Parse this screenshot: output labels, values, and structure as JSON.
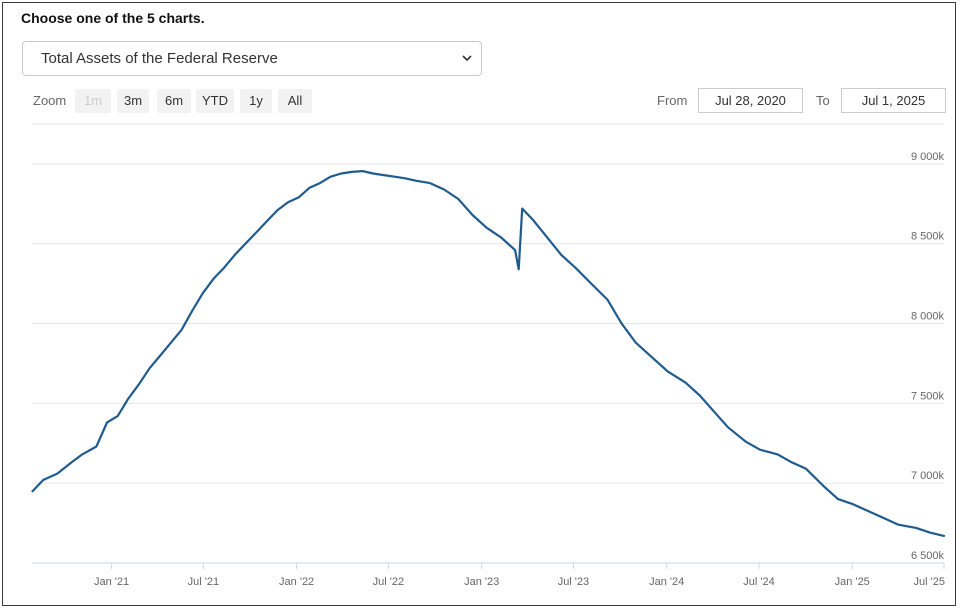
{
  "heading": "Choose one of the 5 charts.",
  "selector": {
    "selected": "Total Assets of the Federal Reserve"
  },
  "zoom": {
    "label": "Zoom",
    "buttons": [
      "1m",
      "3m",
      "6m",
      "YTD",
      "1y",
      "All"
    ],
    "disabled": "1m"
  },
  "range": {
    "from_label": "From",
    "from": "Jul 28, 2020",
    "to_label": "To",
    "to": "Jul 1, 2025"
  },
  "chart_data": {
    "type": "line",
    "title": "",
    "xlabel": "",
    "ylabel": "",
    "series_color": "#1f5b8f",
    "grid": true,
    "xlim": [
      "2020-07-28",
      "2025-07-01"
    ],
    "ylim": [
      6500,
      9250
    ],
    "y_ticks": [
      6500,
      7000,
      7500,
      8000,
      8500,
      9000
    ],
    "y_tick_labels": [
      "6 500k",
      "7 000k",
      "7 500k",
      "8 000k",
      "8 500k",
      "9 000k"
    ],
    "x_ticks": [
      "2021-01-01",
      "2021-07-01",
      "2022-01-01",
      "2022-07-01",
      "2023-01-01",
      "2023-07-01",
      "2024-01-01",
      "2024-07-01",
      "2025-01-01",
      "2025-07-01"
    ],
    "x_tick_labels": [
      "Jan '21",
      "Jul '21",
      "Jan '22",
      "Jul '22",
      "Jan '23",
      "Jul '23",
      "Jan '24",
      "Jul '24",
      "Jan '25",
      "Jul '25"
    ],
    "series": [
      {
        "x": [
          "2020-07-29",
          "2020-08-19",
          "2020-09-16",
          "2020-10-14",
          "2020-11-04",
          "2020-12-02",
          "2020-12-23",
          "2021-01-13",
          "2021-02-03",
          "2021-02-24",
          "2021-03-17",
          "2021-04-07",
          "2021-04-28",
          "2021-05-19",
          "2021-06-09",
          "2021-06-30",
          "2021-07-21",
          "2021-08-11",
          "2021-09-01",
          "2021-09-22",
          "2021-10-13",
          "2021-11-03",
          "2021-11-24",
          "2021-12-15",
          "2022-01-05",
          "2022-01-26",
          "2022-02-16",
          "2022-03-09",
          "2022-03-30",
          "2022-04-20",
          "2022-05-11",
          "2022-06-01",
          "2022-06-22",
          "2022-07-13",
          "2022-08-03",
          "2022-08-24",
          "2022-09-21",
          "2022-10-19",
          "2022-11-16",
          "2022-12-14",
          "2023-01-11",
          "2023-02-08",
          "2023-03-08",
          "2023-03-15",
          "2023-03-22",
          "2023-04-12",
          "2023-05-10",
          "2023-06-07",
          "2023-07-05",
          "2023-08-02",
          "2023-09-06",
          "2023-10-04",
          "2023-11-01",
          "2023-12-06",
          "2024-01-03",
          "2024-02-07",
          "2024-03-06",
          "2024-04-03",
          "2024-05-01",
          "2024-06-05",
          "2024-07-03",
          "2024-08-07",
          "2024-09-04",
          "2024-10-02",
          "2024-11-06",
          "2024-12-04",
          "2025-01-01",
          "2025-02-05",
          "2025-03-05",
          "2025-04-02",
          "2025-05-07",
          "2025-06-04",
          "2025-07-01"
        ],
        "values": [
          6950,
          7020,
          7060,
          7130,
          7180,
          7230,
          7380,
          7420,
          7530,
          7620,
          7720,
          7800,
          7880,
          7960,
          8080,
          8190,
          8280,
          8350,
          8430,
          8500,
          8570,
          8640,
          8710,
          8760,
          8790,
          8850,
          8880,
          8920,
          8940,
          8950,
          8955,
          8940,
          8930,
          8920,
          8910,
          8895,
          8880,
          8840,
          8780,
          8680,
          8600,
          8540,
          8460,
          8340,
          8720,
          8650,
          8540,
          8430,
          8350,
          8260,
          8150,
          8000,
          7880,
          7780,
          7700,
          7630,
          7550,
          7450,
          7350,
          7260,
          7210,
          7180,
          7130,
          7090,
          6980,
          6900,
          6870,
          6820,
          6780,
          6740,
          6720,
          6690,
          6670
        ]
      }
    ]
  }
}
